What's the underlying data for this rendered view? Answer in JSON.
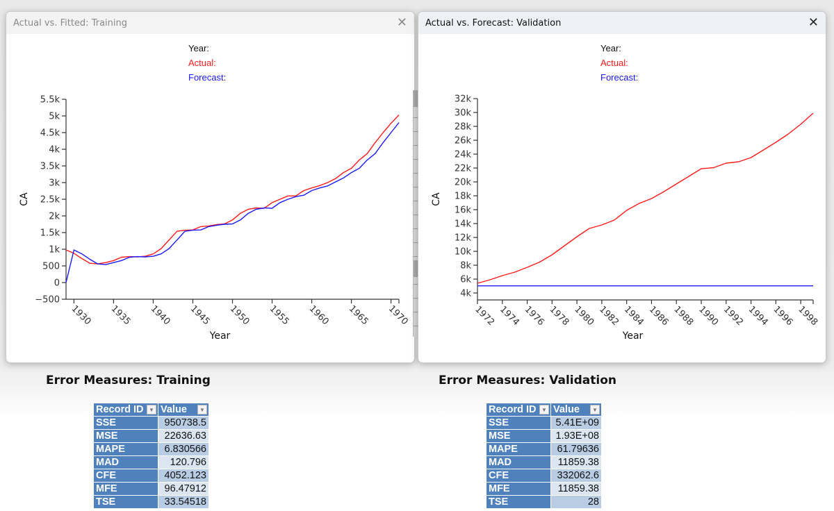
{
  "windows": {
    "training": {
      "title": "Actual vs. Fitted: Training",
      "close_icon": "close-icon",
      "legend": {
        "year": "Year:",
        "actual": "Actual:",
        "forecast": "Forecast:"
      }
    },
    "validation": {
      "title": "Actual vs. Forecast: Validation",
      "close_icon": "close-icon",
      "legend": {
        "year": "Year:",
        "actual": "Actual:",
        "forecast": "Forecast:"
      }
    }
  },
  "colors": {
    "actual": "#ff1a1a",
    "forecast": "#1a1aff",
    "table_header": "#4f81bd"
  },
  "chart_data": [
    {
      "type": "line",
      "title": "Actual vs. Fitted: Training",
      "xlabel": "Year",
      "ylabel": "CA",
      "xlim": [
        1929,
        1971
      ],
      "ylim": [
        -500,
        5500
      ],
      "xticks": [
        1930,
        1935,
        1940,
        1945,
        1950,
        1955,
        1960,
        1965,
        1970
      ],
      "yticks": [
        -500,
        0,
        500,
        1000,
        1500,
        2000,
        2500,
        3000,
        3500,
        4000,
        4500,
        5000,
        5500
      ],
      "ytick_labels": [
        "−500",
        "0",
        "500",
        "1k",
        "1.5k",
        "2k",
        "2.5k",
        "3k",
        "3.5k",
        "4k",
        "4.5k",
        "5k",
        "5.5k"
      ],
      "grid": false,
      "legend": "top-center",
      "x": [
        1929,
        1930,
        1931,
        1932,
        1933,
        1934,
        1935,
        1936,
        1937,
        1938,
        1939,
        1940,
        1941,
        1942,
        1943,
        1944,
        1945,
        1946,
        1947,
        1948,
        1949,
        1950,
        1951,
        1952,
        1953,
        1954,
        1955,
        1956,
        1957,
        1958,
        1959,
        1960,
        1961,
        1962,
        1963,
        1964,
        1965,
        1966,
        1967,
        1968,
        1969,
        1970,
        1971
      ],
      "series": [
        {
          "name": "Actual",
          "color": "#ff1a1a",
          "values": [
            980,
            880,
            720,
            580,
            560,
            600,
            660,
            760,
            780,
            770,
            790,
            860,
            1020,
            1280,
            1540,
            1570,
            1580,
            1680,
            1700,
            1740,
            1760,
            1880,
            2080,
            2200,
            2240,
            2230,
            2400,
            2500,
            2600,
            2600,
            2760,
            2840,
            2910,
            3000,
            3120,
            3300,
            3430,
            3680,
            3870,
            4200,
            4500,
            4780,
            5030
          ]
        },
        {
          "name": "Forecast",
          "color": "#1a1aff",
          "values": [
            0,
            980,
            860,
            700,
            560,
            540,
            600,
            660,
            760,
            780,
            770,
            790,
            860,
            1020,
            1280,
            1540,
            1570,
            1580,
            1680,
            1720,
            1750,
            1760,
            1880,
            2080,
            2200,
            2240,
            2230,
            2400,
            2500,
            2580,
            2620,
            2760,
            2840,
            2900,
            3020,
            3140,
            3300,
            3430,
            3680,
            3870,
            4200,
            4500,
            4800
          ]
        }
      ]
    },
    {
      "type": "line",
      "title": "Actual vs. Forecast: Validation",
      "xlabel": "Year",
      "ylabel": "CA",
      "xlim": [
        1972,
        1999
      ],
      "ylim": [
        3000,
        32000
      ],
      "xticks": [
        1972,
        1974,
        1976,
        1978,
        1980,
        1982,
        1984,
        1986,
        1988,
        1990,
        1992,
        1994,
        1996,
        1998
      ],
      "yticks": [
        4000,
        6000,
        8000,
        10000,
        12000,
        14000,
        16000,
        18000,
        20000,
        22000,
        24000,
        26000,
        28000,
        30000,
        32000
      ],
      "ytick_labels": [
        "4k",
        "6k",
        "8k",
        "10k",
        "12k",
        "14k",
        "16k",
        "18k",
        "20k",
        "22k",
        "24k",
        "26k",
        "28k",
        "30k",
        "32k"
      ],
      "grid": false,
      "legend": "top-center",
      "x": [
        1972,
        1973,
        1974,
        1975,
        1976,
        1977,
        1978,
        1979,
        1980,
        1981,
        1982,
        1983,
        1984,
        1985,
        1986,
        1987,
        1988,
        1989,
        1990,
        1991,
        1992,
        1993,
        1994,
        1995,
        1996,
        1997,
        1998,
        1999
      ],
      "series": [
        {
          "name": "Actual",
          "color": "#ff1a1a",
          "values": [
            5400,
            5900,
            6500,
            7000,
            7700,
            8450,
            9500,
            10800,
            12100,
            13300,
            13800,
            14500,
            15900,
            16900,
            17600,
            18600,
            19700,
            20800,
            21900,
            22050,
            22700,
            22900,
            23500,
            24600,
            25700,
            26900,
            28300,
            29900
          ]
        },
        {
          "name": "Forecast",
          "color": "#1a1aff",
          "values": [
            5030,
            5030,
            5030,
            5030,
            5030,
            5030,
            5030,
            5030,
            5030,
            5030,
            5030,
            5030,
            5030,
            5030,
            5030,
            5030,
            5030,
            5030,
            5030,
            5030,
            5030,
            5030,
            5030,
            5030,
            5030,
            5030,
            5030,
            5030
          ]
        }
      ]
    }
  ],
  "error_measures": {
    "training": {
      "title": "Error Measures: Training",
      "headers": [
        "Record ID",
        "Value"
      ],
      "rows": [
        {
          "id": "SSE",
          "value": "950738.5"
        },
        {
          "id": "MSE",
          "value": "22636.63"
        },
        {
          "id": "MAPE",
          "value": "6.830566"
        },
        {
          "id": "MAD",
          "value": "120.796"
        },
        {
          "id": "CFE",
          "value": "4052.123"
        },
        {
          "id": "MFE",
          "value": "96.47912"
        },
        {
          "id": "TSE",
          "value": "33.54518"
        }
      ]
    },
    "validation": {
      "title": "Error Measures: Validation",
      "headers": [
        "Record ID",
        "Value"
      ],
      "rows": [
        {
          "id": "SSE",
          "value": "5.41E+09"
        },
        {
          "id": "MSE",
          "value": "1.93E+08"
        },
        {
          "id": "MAPE",
          "value": "61.79636"
        },
        {
          "id": "MAD",
          "value": "11859.38"
        },
        {
          "id": "CFE",
          "value": "332062.6"
        },
        {
          "id": "MFE",
          "value": "11859.38"
        },
        {
          "id": "TSE",
          "value": "28"
        }
      ]
    }
  }
}
